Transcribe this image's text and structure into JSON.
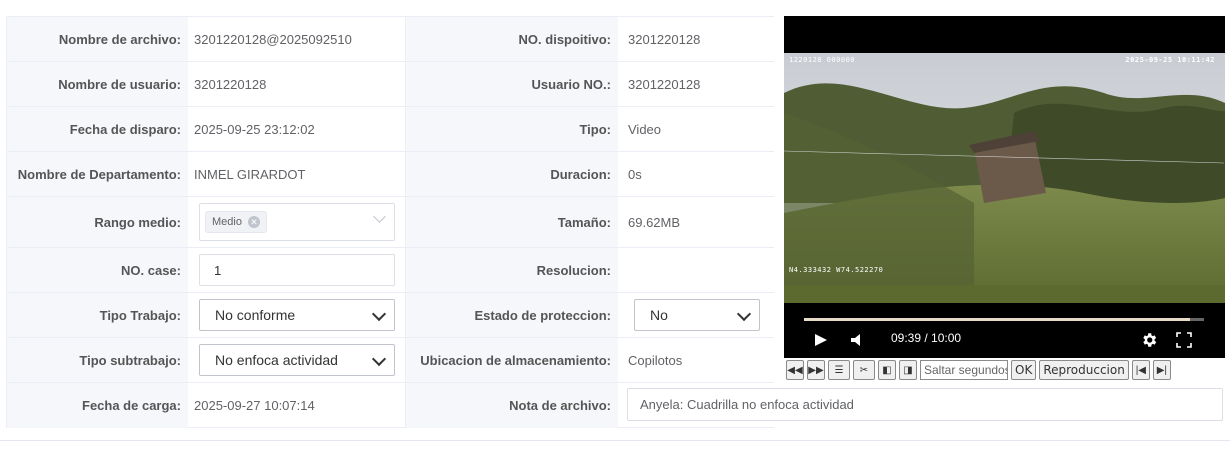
{
  "fields": [
    {
      "label": "Nombre de archivo:",
      "value": "3201220128@2025092510",
      "label2": "NO. dispoitivo:",
      "value2": "3201220128"
    },
    {
      "label": "Nombre de usuario:",
      "value": "3201220128",
      "label2": "Usuario NO.:",
      "value2": "3201220128"
    },
    {
      "label": "Fecha de disparo:",
      "value": "2025-09-25 23:12:02",
      "label2": "Tipo:",
      "value2": "Video"
    },
    {
      "label": "Nombre de Departamento:",
      "value": "INMEL GIRARDOT",
      "label2": "Duracion:",
      "value2": "0s"
    },
    {
      "label": "Rango medio:",
      "value": "Medio",
      "label2": "Tamaño:",
      "value2": "69.62MB"
    },
    {
      "label": "NO. case:",
      "value": "1",
      "label2": "Resolucion:",
      "value2": ""
    },
    {
      "label": "Tipo Trabajo:",
      "value": "No conforme",
      "label2": "Estado de proteccion:",
      "value2": "No"
    },
    {
      "label": "Tipo subtrabajo:",
      "value": "No enfoca actividad",
      "label2": "Ubicacion de almacenamiento:",
      "value2": "Copilotos"
    },
    {
      "label": "Fecha de carga:",
      "value": "2025-09-27 10:07:14",
      "label2": "Nota de archivo:",
      "value2": "Anyela: Cuadrilla no enfoca actividad"
    }
  ],
  "video": {
    "osd_left": "1220128 000000",
    "osd_right": "2025-09-25 10:11:42",
    "osd_coords": "N4.333432 W74.522270",
    "time": "09:39 / 10:00",
    "progress": 0.965
  },
  "toolbar": {
    "rewind_icon": "rewind-icon",
    "forward_icon": "fast-forward-icon",
    "list_icon": "list-icon",
    "cut_icon": "scissors-icon",
    "prev_frame_icon": "prev-frame-icon",
    "next_frame_icon": "next-frame-icon",
    "seek_placeholder": "Saltar segundos",
    "ok_label": "OK",
    "playback_label": "Reproduccion"
  },
  "colors": {
    "label_bg": "#f5f7fa",
    "border": "#ebeef5",
    "video_bg": "#000000"
  }
}
